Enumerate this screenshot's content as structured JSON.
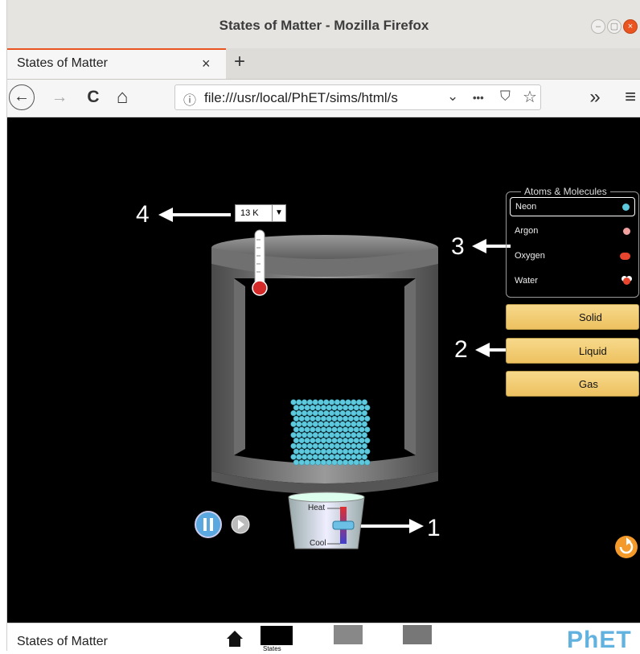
{
  "window": {
    "title": "States of Matter - Mozilla Firefox"
  },
  "tab": {
    "label": "States of Matter",
    "close": "×",
    "new_tab": "+"
  },
  "nav": {
    "back": "←",
    "forward": "→",
    "reload": "C",
    "home": "⌂",
    "url_info": "ⓘ",
    "url": "file:///usr/local/PhET/sims/html/s",
    "url_dropdown": "⌄",
    "page_actions": "•••",
    "pocket": "⛉",
    "bookmark": "☆",
    "overflow": "»",
    "menu": "≡"
  },
  "sim": {
    "temperature": {
      "value": "13 K",
      "arrow": "▼"
    },
    "molecules": {
      "title": "Atoms & Molecules",
      "items": [
        {
          "label": "Neon",
          "color": "#5ec8dd",
          "selected": true
        },
        {
          "label": "Argon",
          "color": "#f2a1a1",
          "selected": false
        },
        {
          "label": "Oxygen",
          "color": "#e8442e",
          "selected": false
        },
        {
          "label": "Water",
          "color": "#ffffff",
          "selected": false
        }
      ]
    },
    "states": [
      {
        "label": "Solid",
        "icon": "ice-cube-icon"
      },
      {
        "label": "Liquid",
        "icon": "droplet-icon"
      },
      {
        "label": "Gas",
        "icon": "cloud-icon"
      }
    ],
    "heater": {
      "heat_label": "Heat",
      "cool_label": "Cool"
    },
    "annotations": {
      "a1": "1",
      "a2": "2",
      "a3": "3",
      "a4": "4"
    },
    "colors": {
      "particle": "#5ec8dd",
      "state_button": "#f2cd74",
      "reset": "#f39a2b",
      "play": "#5aa8df"
    }
  },
  "footer": {
    "app_title": "States of Matter",
    "screen_labels": [
      "States"
    ],
    "logo": "PhET"
  }
}
